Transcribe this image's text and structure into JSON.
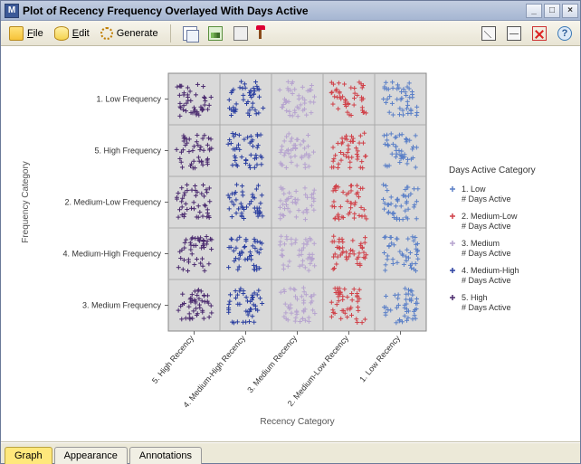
{
  "window": {
    "title": "Plot of Recency Frequency Overlayed With Days Active"
  },
  "menus": {
    "file": "File",
    "edit": "Edit",
    "generate": "Generate"
  },
  "tabs": {
    "graph": "Graph",
    "appearance": "Appearance",
    "annotations": "Annotations"
  },
  "chart_data": {
    "type": "scatter",
    "title": "",
    "xlabel": "Recency Category",
    "ylabel": "Frequency Category",
    "y_categories": [
      "1. Low Frequency",
      "5. High Frequency",
      "2. Medium-Low Frequency",
      "4. Medium-High Frequency",
      "3. Medium Frequency"
    ],
    "x_categories": [
      "5. High Recency",
      "4. Medium-High Recency",
      "3. Medium Recency",
      "2. Medium-Low Recency",
      "1. Low Recency"
    ],
    "legend_title": "Days Active Category",
    "series": [
      {
        "name": "1. Low # Days Active",
        "color": "#5a7fc7"
      },
      {
        "name": "2. Medium-Low # Days Active",
        "color": "#d04048"
      },
      {
        "name": "3. Medium # Days Active",
        "color": "#b6a3cf"
      },
      {
        "name": "4. Medium-High # Days Active",
        "color": "#2b3fa0"
      },
      {
        "name": "5. High # Days Active",
        "color": "#4a2a6e"
      }
    ],
    "grid_composition_note": "Each cell (x,y) shows a jittered cluster whose color corresponds to the series where the series' numeric rank matches the x-category's numeric rank (column-based coloring)."
  }
}
